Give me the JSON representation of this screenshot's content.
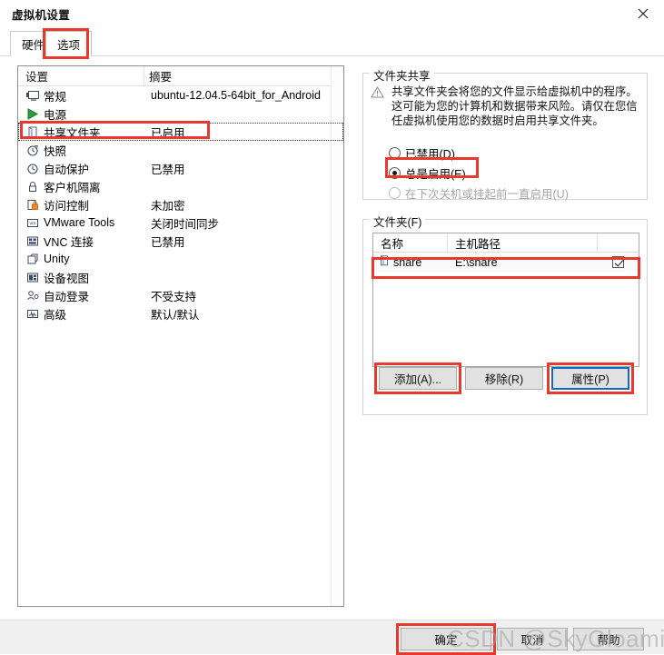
{
  "window": {
    "title": "虚拟机设置",
    "close_icon": "close-icon"
  },
  "tabs": [
    {
      "label": "硬件",
      "name": "tab-hardware",
      "selected": false
    },
    {
      "label": "选项",
      "name": "tab-options",
      "selected": true
    }
  ],
  "settings_list": {
    "columns": [
      "设置",
      "摘要"
    ],
    "rows": [
      {
        "icon": "monitor-icon",
        "label": "常规",
        "summary": "ubuntu-12.04.5-64bit_for_Android"
      },
      {
        "icon": "power-icon",
        "label": "电源",
        "summary": ""
      },
      {
        "icon": "shared-folder-icon",
        "label": "共享文件夹",
        "summary": "已启用"
      },
      {
        "icon": "snapshot-icon",
        "label": "快照",
        "summary": ""
      },
      {
        "icon": "clock-icon",
        "label": "自动保护",
        "summary": "已禁用"
      },
      {
        "icon": "lock-icon",
        "label": "客户机隔离",
        "summary": ""
      },
      {
        "icon": "access-lock-icon",
        "label": "访问控制",
        "summary": "未加密"
      },
      {
        "icon": "vmware-tools-icon",
        "label": "VMware Tools",
        "summary": "关闭时间同步"
      },
      {
        "icon": "vnc-icon",
        "label": "VNC 连接",
        "summary": "已禁用"
      },
      {
        "icon": "unity-icon",
        "label": "Unity",
        "summary": ""
      },
      {
        "icon": "device-view-icon",
        "label": "设备视图",
        "summary": ""
      },
      {
        "icon": "autologin-icon",
        "label": "自动登录",
        "summary": "不受支持"
      },
      {
        "icon": "advanced-icon",
        "label": "高级",
        "summary": "默认/默认"
      }
    ],
    "selected_index": 2
  },
  "folder_sharing": {
    "legend": "文件夹共享",
    "warning_icon": "warning-triangle-icon",
    "warning_text": "共享文件夹会将您的文件显示给虚拟机中的程序。这可能为您的计算机和数据带来风险。请仅在您信任虚拟机使用您的数据时启用共享文件夹。",
    "options": [
      {
        "label": "已禁用(D)",
        "selected": false,
        "disabled": false
      },
      {
        "label": "总是启用(E)",
        "selected": true,
        "disabled": false
      },
      {
        "label": "在下次关机或挂起前一直启用(U)",
        "selected": false,
        "disabled": true
      }
    ]
  },
  "folders": {
    "legend": "文件夹(F)",
    "columns": [
      "名称",
      "主机路径",
      ""
    ],
    "rows": [
      {
        "icon": "folder-icon",
        "name": "share",
        "host_path": "E:\\share",
        "enabled": true
      }
    ],
    "buttons": {
      "add": "添加(A)...",
      "remove": "移除(R)",
      "properties": "属性(P)"
    }
  },
  "dialog_buttons": {
    "ok": "确定",
    "cancel": "取消",
    "help": "帮助"
  },
  "watermark": "CSDN @SkyGloaming",
  "colors": {
    "annotation_red": "#e8392e",
    "focus_blue": "#0a6cc4",
    "footer_bg": "#f0f0f0",
    "button_bg": "#e1e1e1"
  }
}
